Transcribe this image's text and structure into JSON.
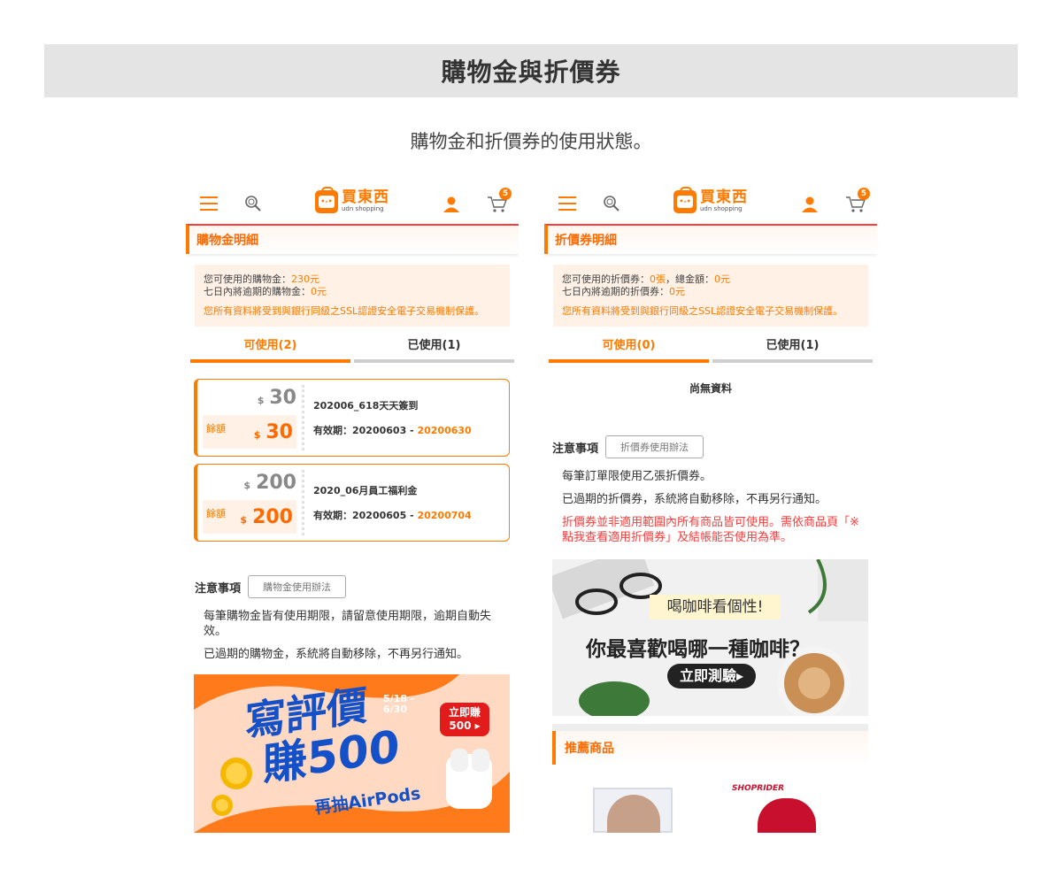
{
  "header": {
    "title": "購物金與折價券"
  },
  "subtitle": "購物金和折價券的使用狀態。",
  "nav": {
    "logo_cn": "買東西",
    "logo_en": "udn shopping",
    "cart_count": "5"
  },
  "left": {
    "section_title": "購物金明細",
    "info": {
      "line1_label": "您可使用的購物金：",
      "line1_value": "230元",
      "line2_label": "七日內將逾期的購物金：",
      "line2_value": "0元",
      "notice": "您所有資料將受到與銀行同級之SSL認證安全電子交易機制保護。"
    },
    "tabs": [
      {
        "label": "可使用(2)"
      },
      {
        "label": "已使用(1)"
      }
    ],
    "coupons": [
      {
        "currency": "$",
        "amount": "30",
        "balance_label": "餘額",
        "balance": "30",
        "name": "202006_618天天簽到",
        "valid_label": "有效期：20200603 - ",
        "valid_end": "20200630"
      },
      {
        "currency": "$",
        "amount": "200",
        "balance_label": "餘額",
        "balance": "200",
        "name": "2020_06月員工福利金",
        "valid_label": "有效期：20200605 - ",
        "valid_end": "20200704"
      }
    ],
    "notes": {
      "title": "注意事項",
      "button": "購物金使用辦法",
      "lines": [
        "每筆購物金皆有使用期限，請留意使用期限，逾期自動失效。",
        "已過期的購物金，系統將自動移除，不再另行通知。"
      ]
    },
    "banner": {
      "line1": "寫評價",
      "line2": "賺500",
      "date": "5/18 - 6/30",
      "cta": "立即賺 500 ▸",
      "sub": "再抽AirPods"
    }
  },
  "right": {
    "section_title": "折價券明細",
    "info": {
      "line1_label": "您可使用的折價券：",
      "line1_value": "0張",
      "line1_mid": "，總金額：",
      "line1_value2": "0元",
      "line2_label": "七日內將逾期的折價券：",
      "line2_value": "0元",
      "notice": "您所有資料將受到與銀行同級之SSL認證安全電子交易機制保護。"
    },
    "tabs": [
      {
        "label": "可使用(0)"
      },
      {
        "label": "已使用(1)"
      }
    ],
    "empty": "尚無資料",
    "notes": {
      "title": "注意事項",
      "button": "折價券使用辦法",
      "lines": [
        "每筆訂單限使用乙張折價券。",
        "已過期的折價券，系統將自動移除，不再另行通知。"
      ],
      "red": "折價券並非適用範圍內所有商品皆可使用。需依商品頁「※點我查看適用折價券」及結帳能否使用為準。"
    },
    "banner": {
      "top": "喝咖啡看個性!",
      "main": "你最喜歡喝哪一種咖啡？",
      "cta": "立即測驗▸"
    },
    "recommend_title": "推薦商品",
    "product_brand": "SHOPRIDER"
  },
  "colors": {
    "accent": "#ff7a00",
    "red": "#ff3b3b",
    "banner_orange": "#ff7a1a",
    "banner_blue": "#1450c8"
  }
}
